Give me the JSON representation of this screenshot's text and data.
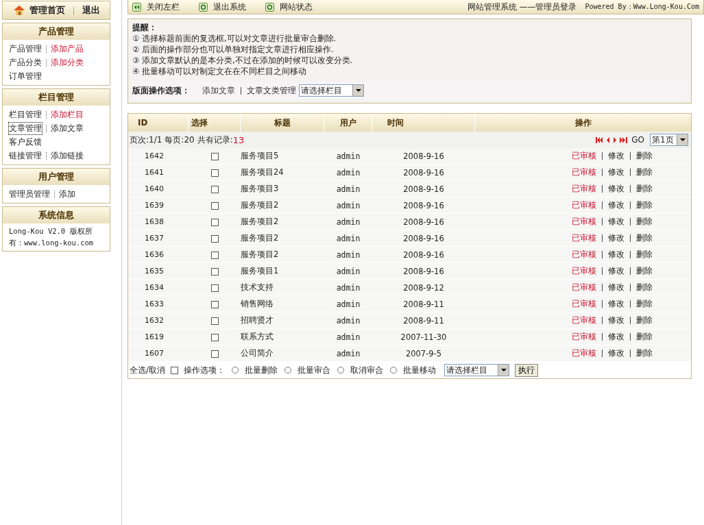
{
  "sidebar": {
    "home": "管理首页",
    "logout": "退出",
    "sections": [
      {
        "title": "产品管理",
        "rows": [
          [
            {
              "label": "产品管理",
              "highlighted": false,
              "focused": false
            },
            {
              "label": "添加产品",
              "highlighted": true,
              "focused": false
            }
          ],
          [
            {
              "label": "产品分类",
              "highlighted": false,
              "focused": false
            },
            {
              "label": "添加分类",
              "highlighted": true,
              "focused": false
            }
          ],
          [
            {
              "label": "订单管理",
              "highlighted": false,
              "focused": false
            }
          ]
        ]
      },
      {
        "title": "栏目管理",
        "rows": [
          [
            {
              "label": "栏目管理",
              "highlighted": false,
              "focused": false
            },
            {
              "label": "添加栏目",
              "highlighted": true,
              "focused": false
            }
          ],
          [
            {
              "label": "文章管理",
              "highlighted": false,
              "focused": true
            },
            {
              "label": "添加文章",
              "highlighted": false,
              "focused": false
            }
          ],
          [
            {
              "label": "客户反馈",
              "highlighted": false,
              "focused": false
            }
          ],
          [
            {
              "label": "链接管理",
              "highlighted": false,
              "focused": false
            },
            {
              "label": "添加链接",
              "highlighted": false,
              "focused": false
            }
          ]
        ]
      },
      {
        "title": "用户管理",
        "rows": [
          [
            {
              "label": "管理员管理",
              "highlighted": false,
              "focused": false
            },
            {
              "label": "添加",
              "highlighted": false,
              "focused": false
            }
          ]
        ]
      }
    ],
    "info": {
      "title": "系统信息",
      "text": "Long-Kou V2.0 版权所有：www.long-kou.com"
    }
  },
  "topbar": {
    "links": [
      "关闭左栏",
      "退出系统",
      "网站状态"
    ],
    "system": "网站管理系统 ——管理员登录",
    "powered": "Powered By：Www.Long-Kou.Com"
  },
  "notice": {
    "title": "提醒：",
    "items": [
      "① 选择标题前面的复选框,可以对文章进行批量审合删除.",
      "② 后面的操作部分也可以单独对指定文章进行相应操作.",
      "③ 添加文章默认的是本分类,不过在添加的时候可以改变分类.",
      "④ 批量移动可以对制定文在在不同栏目之间移动"
    ],
    "options_label": "版面操作选项：",
    "links": [
      "添加文章",
      "文章文类管理"
    ],
    "select": "请选择栏目"
  },
  "table": {
    "columns": [
      "ID",
      "选择",
      "标题",
      "用户",
      "时间",
      "操作"
    ],
    "pager": {
      "page": "页次:1/1",
      "per_page": "每页:20",
      "total_label": "共有记录:",
      "total": "13",
      "go": "GO",
      "select": "第1页"
    },
    "rows": [
      {
        "id": "1642",
        "checked": false,
        "title": "服务项目5",
        "user": "admin",
        "time": "2008-9-16",
        "status": "已审核",
        "edit": "修改",
        "delete": "删除"
      },
      {
        "id": "1641",
        "checked": false,
        "title": "服务项目24",
        "user": "admin",
        "time": "2008-9-16",
        "status": "已审核",
        "edit": "修改",
        "delete": "删除"
      },
      {
        "id": "1640",
        "checked": false,
        "title": "服务项目3",
        "user": "admin",
        "time": "2008-9-16",
        "status": "已审核",
        "edit": "修改",
        "delete": "删除"
      },
      {
        "id": "1639",
        "checked": false,
        "title": "服务项目2",
        "user": "admin",
        "time": "2008-9-16",
        "status": "已审核",
        "edit": "修改",
        "delete": "删除"
      },
      {
        "id": "1638",
        "checked": false,
        "title": "服务项目2",
        "user": "admin",
        "time": "2008-9-16",
        "status": "已审核",
        "edit": "修改",
        "delete": "删除"
      },
      {
        "id": "1637",
        "checked": false,
        "title": "服务项目2",
        "user": "admin",
        "time": "2008-9-16",
        "status": "已审核",
        "edit": "修改",
        "delete": "删除"
      },
      {
        "id": "1636",
        "checked": false,
        "title": "服务项目2",
        "user": "admin",
        "time": "2008-9-16",
        "status": "已审核",
        "edit": "修改",
        "delete": "删除"
      },
      {
        "id": "1635",
        "checked": false,
        "title": "服务项目1",
        "user": "admin",
        "time": "2008-9-16",
        "status": "已审核",
        "edit": "修改",
        "delete": "删除"
      },
      {
        "id": "1634",
        "checked": false,
        "title": "技术支持",
        "user": "admin",
        "time": "2008-9-12",
        "status": "已审核",
        "edit": "修改",
        "delete": "删除"
      },
      {
        "id": "1633",
        "checked": false,
        "title": "销售网络",
        "user": "admin",
        "time": "2008-9-11",
        "status": "已审核",
        "edit": "修改",
        "delete": "删除"
      },
      {
        "id": "1632",
        "checked": false,
        "title": "招聘贤才",
        "user": "admin",
        "time": "2008-9-11",
        "status": "已审核",
        "edit": "修改",
        "delete": "删除"
      },
      {
        "id": "1619",
        "checked": false,
        "title": "联系方式",
        "user": "admin",
        "time": "2007-11-30",
        "status": "已审核",
        "edit": "修改",
        "delete": "删除"
      },
      {
        "id": "1607",
        "checked": false,
        "title": "公司简介",
        "user": "admin",
        "time": "2007-9-5",
        "status": "已审核",
        "edit": "修改",
        "delete": "删除"
      }
    ],
    "footer": {
      "select_all": "全选/取消",
      "select_all_checked": false,
      "options_label": "操作选项：",
      "actions": [
        {
          "label": "批量删除",
          "selected": false
        },
        {
          "label": "批量审合",
          "selected": false
        },
        {
          "label": "取消审合",
          "selected": false
        },
        {
          "label": "批量移动",
          "selected": false
        }
      ],
      "select": "请选择栏目",
      "submit": "执行"
    }
  }
}
